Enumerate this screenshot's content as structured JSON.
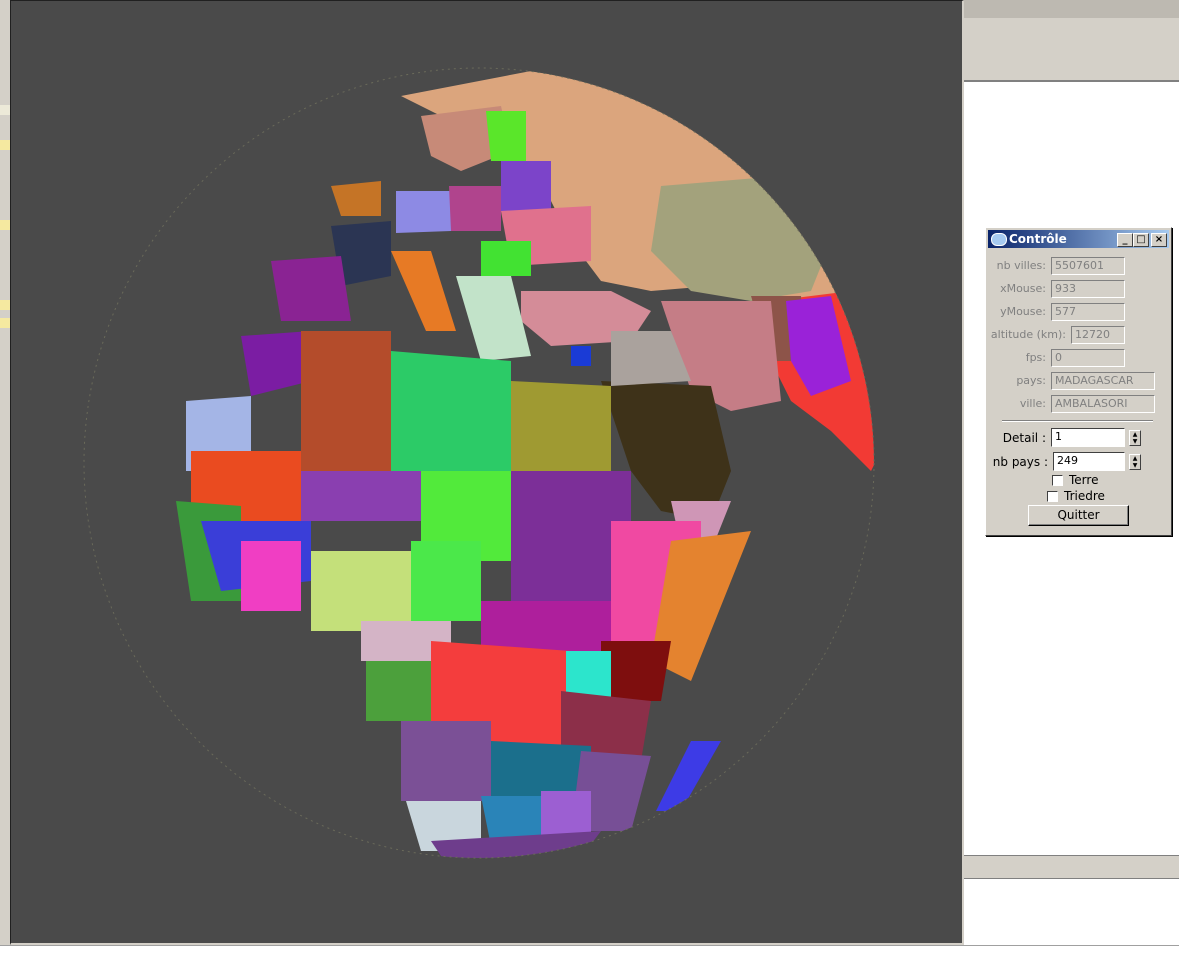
{
  "panel": {
    "title": "Contrôle",
    "fields": [
      {
        "label": "nb villes:",
        "value": "5507601"
      },
      {
        "label": "xMouse:",
        "value": "933"
      },
      {
        "label": "yMouse:",
        "value": "577"
      },
      {
        "label": "altitude (km):",
        "value": "12720"
      },
      {
        "label": "fps:",
        "value": "0"
      },
      {
        "label": "pays:",
        "value": "MADAGASCAR"
      },
      {
        "label": "ville:",
        "value": "AMBALASORI"
      }
    ],
    "detail": {
      "label": "Detail :",
      "value": "1"
    },
    "nb_pays": {
      "label": "nb pays :",
      "value": "249"
    },
    "checkboxes": [
      {
        "label": "Terre",
        "checked": false
      },
      {
        "label": "Triedre",
        "checked": false
      }
    ],
    "quit_label": "Quitter"
  },
  "colors": {
    "view_background": "#4a4a4a",
    "titlebar_start": "#0a246a",
    "titlebar_end": "#a6caf0"
  }
}
